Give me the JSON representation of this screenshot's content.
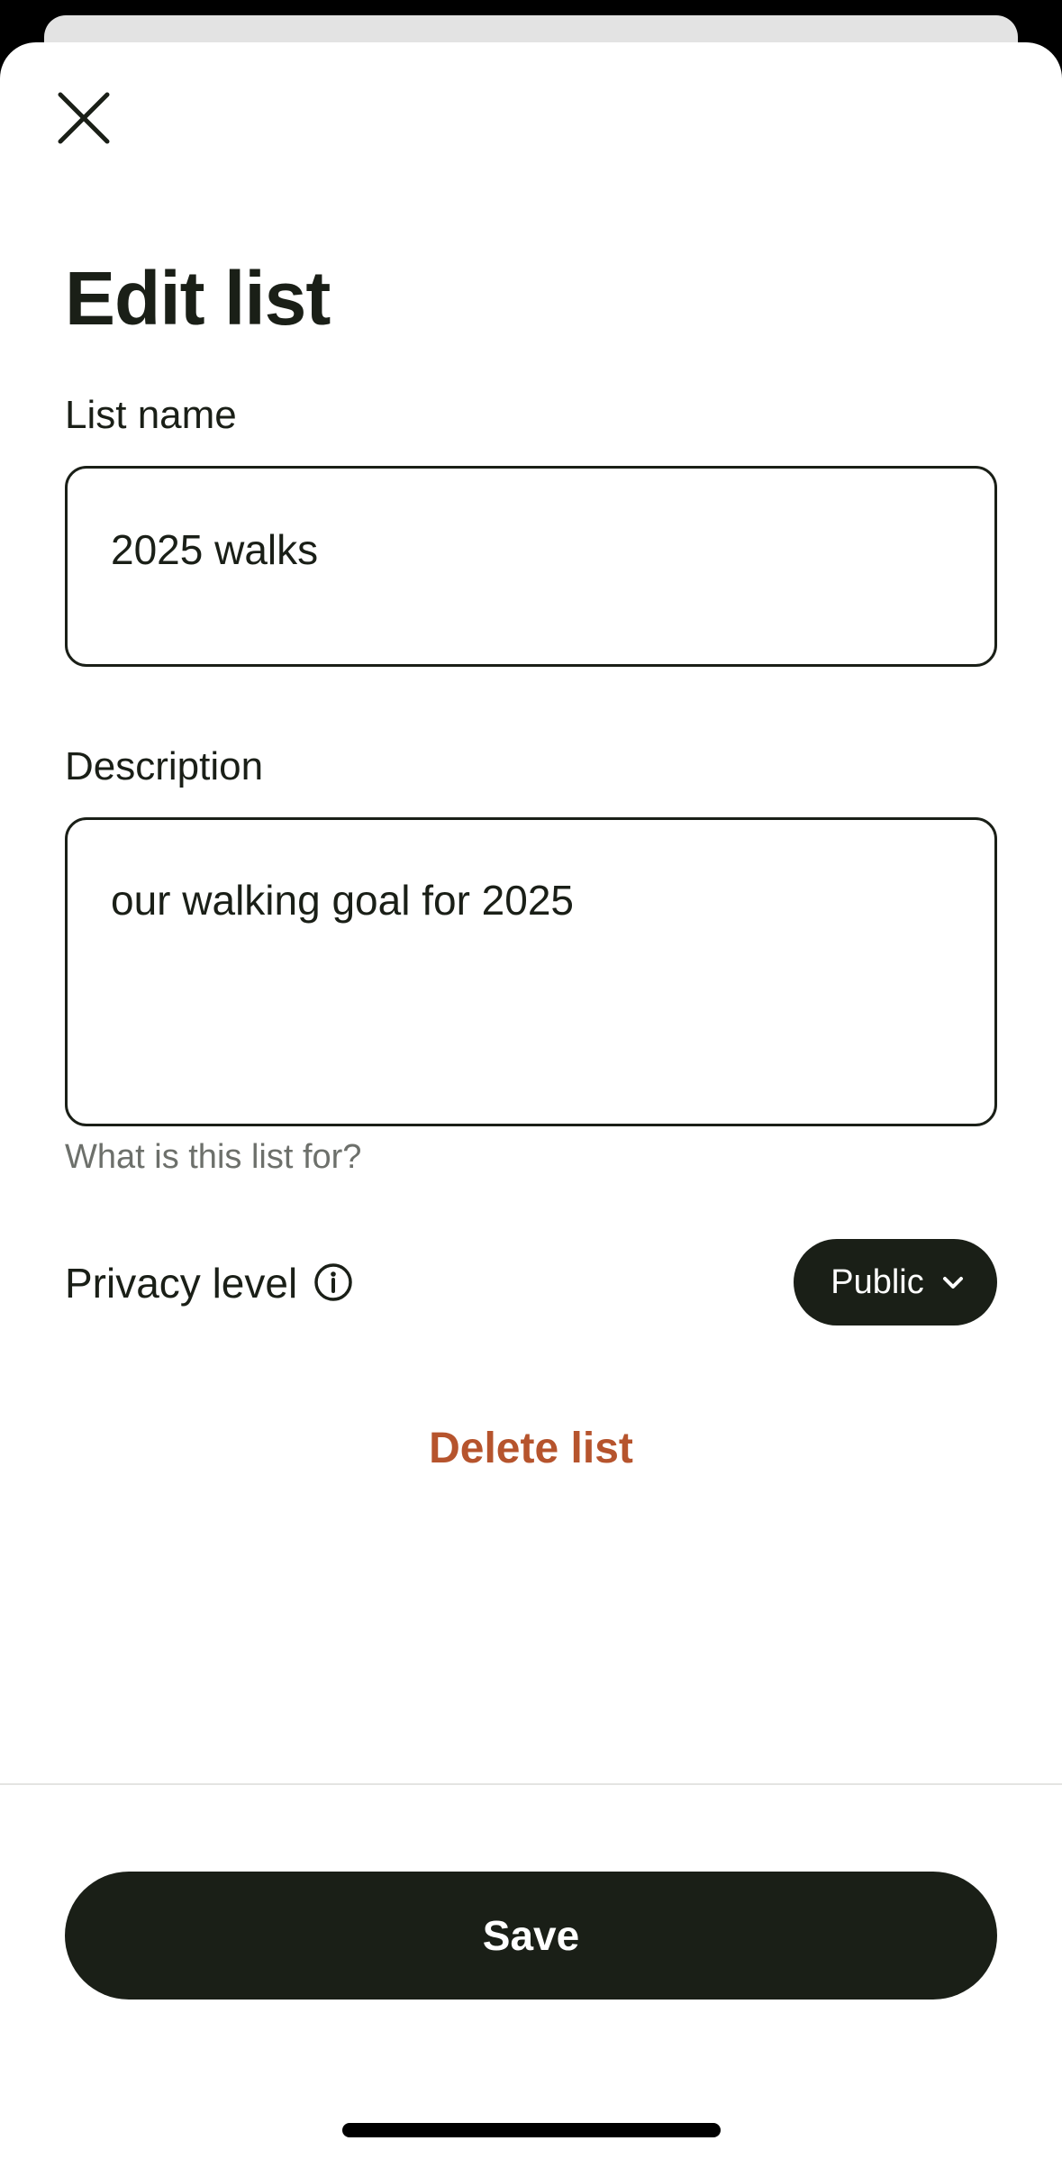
{
  "sheet": {
    "title": "Edit list"
  },
  "form": {
    "list_name": {
      "label": "List name",
      "value": "2025 walks"
    },
    "description": {
      "label": "Description",
      "value": "our walking goal for 2025",
      "helper": "What is this list for?"
    },
    "privacy": {
      "label": "Privacy level",
      "selected": "Public"
    }
  },
  "actions": {
    "delete_label": "Delete list",
    "save_label": "Save"
  },
  "icons": {
    "close": "close-icon",
    "info": "info-icon",
    "dropdown": "chevron-down-icon"
  },
  "colors": {
    "primary_dark": "#1a1f17",
    "destructive": "#b6542d",
    "helper_gray": "#6d706b"
  }
}
